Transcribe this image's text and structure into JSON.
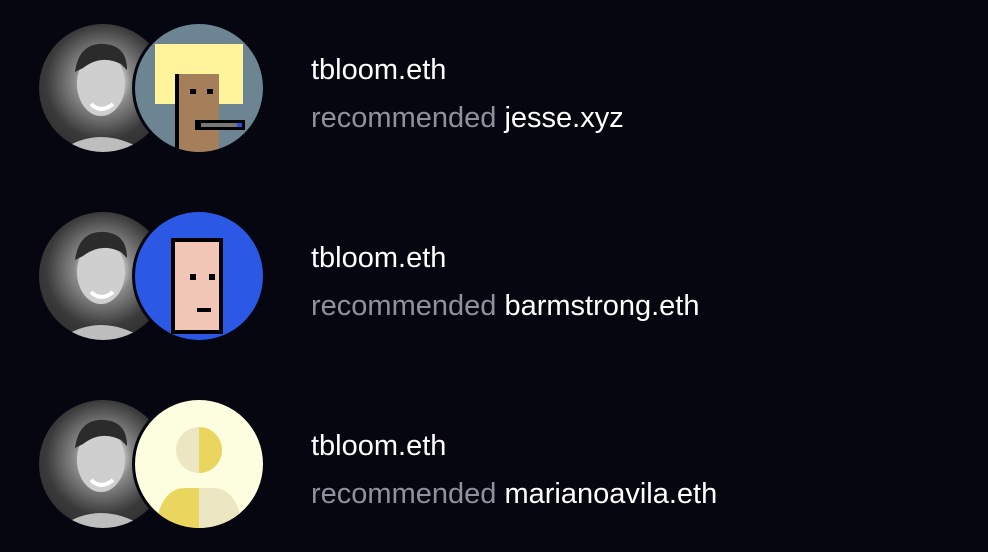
{
  "feed": [
    {
      "actor": "tbloom.eth",
      "action": "recommended",
      "target": "jesse.xyz",
      "target_avatar": "pixel-punk-blonde-avatar"
    },
    {
      "actor": "tbloom.eth",
      "action": "recommended",
      "target": "barmstrong.eth",
      "target_avatar": "pixel-punk-blue-avatar"
    },
    {
      "actor": "tbloom.eth",
      "action": "recommended",
      "target": "marianoavila.eth",
      "target_avatar": "default-user-avatar"
    }
  ]
}
